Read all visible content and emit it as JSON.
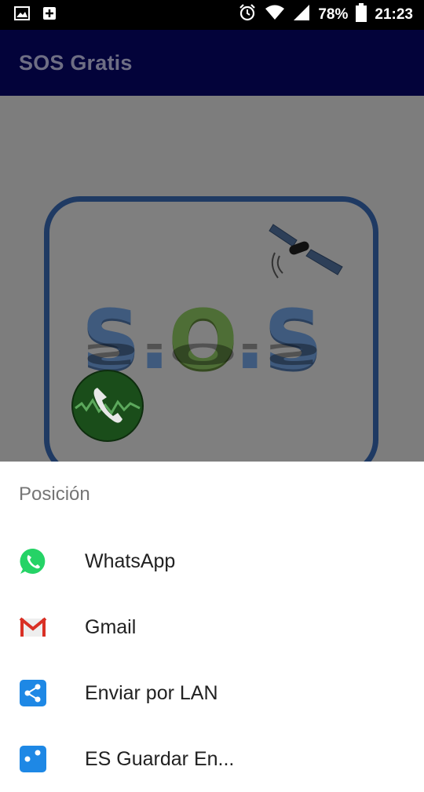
{
  "status_bar": {
    "battery": "78%",
    "time": "21:23",
    "icons": [
      "image-icon",
      "add-box-icon",
      "alarm-icon",
      "wifi-icon",
      "signal-icon",
      "battery-icon"
    ]
  },
  "app_bar": {
    "title": "SOS Gratis"
  },
  "logo": {
    "letters": [
      "S",
      ".",
      "O",
      ".",
      "S"
    ]
  },
  "share_sheet": {
    "title": "Posición",
    "items": [
      {
        "label": "WhatsApp",
        "icon": "whatsapp-icon",
        "color": "#25D366"
      },
      {
        "label": "Gmail",
        "icon": "gmail-icon",
        "color": "#D93025"
      },
      {
        "label": "Enviar por LAN",
        "icon": "lan-share-icon",
        "color": "#1E88E5"
      },
      {
        "label": "ES Guardar En...",
        "icon": "es-save-icon",
        "color": "#1E88E5"
      }
    ]
  }
}
